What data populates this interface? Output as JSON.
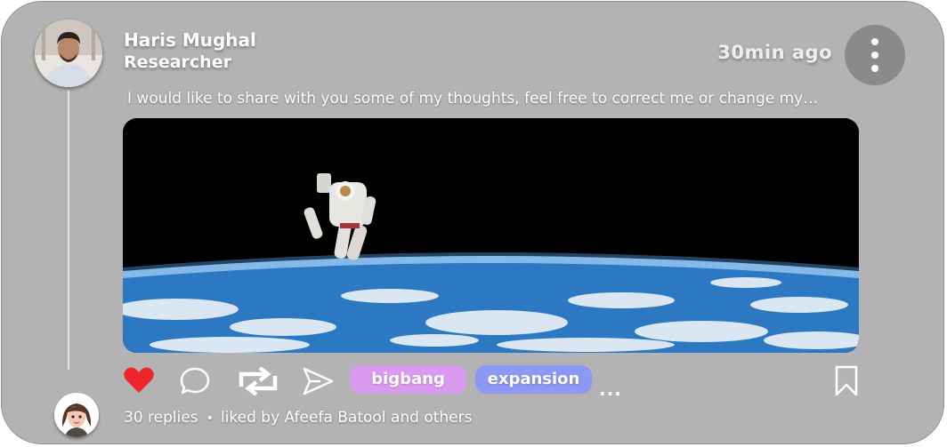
{
  "post": {
    "author_name": "Haris Mughal",
    "author_role": "Researcher",
    "time_ago": "30min ago",
    "text": "I would like to share with you some of my thoughts, feel free to correct me or change my…",
    "tags": [
      "bigbang",
      "expansion"
    ],
    "tags_more": "...",
    "replies": "30 replies",
    "separator": "•",
    "liked_by": "liked by Afeefa Batool and others"
  },
  "colors": {
    "card_bg": "#b3b3b3",
    "heart": "#f0262c",
    "tag_bigbang": "#d99af0",
    "tag_expansion": "#8c98f4",
    "more_button": "#8a8a8a"
  },
  "icons": [
    "more-vertical-icon",
    "heart-icon",
    "comment-icon",
    "repost-icon",
    "send-icon",
    "bookmark-icon"
  ]
}
